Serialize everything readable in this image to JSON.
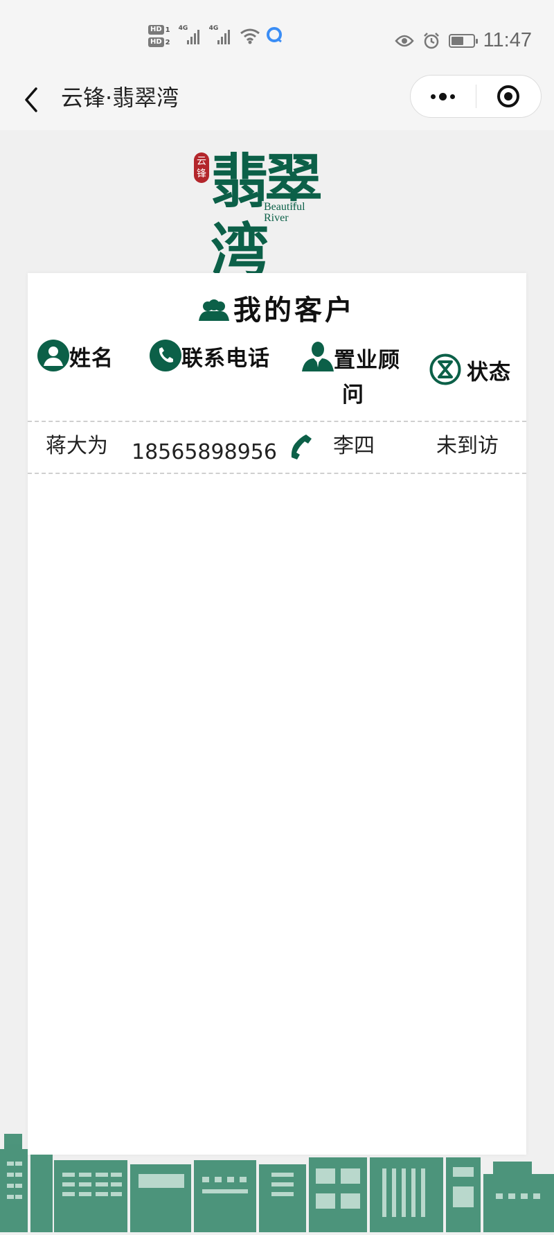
{
  "status_bar": {
    "hd1": "HD",
    "hd1_index": "1",
    "hd2": "HD",
    "hd2_index": "2",
    "network1": "4G",
    "network2": "4G",
    "time": "11:47",
    "battery_level": 0.58
  },
  "nav": {
    "title": "云锋·翡翠湾"
  },
  "logo": {
    "seal_text": "云锋",
    "main": "翡翠湾",
    "sub_line1": "Beautiful",
    "sub_line2": "River"
  },
  "customers": {
    "title": "我的客户",
    "headers": {
      "name": "姓名",
      "phone": "联系电话",
      "consultant_line1": "置业顾",
      "consultant_line2": "问",
      "status": "状态"
    },
    "rows": [
      {
        "name": "蒋大为",
        "phone": "18565898956",
        "consultant": "李四",
        "status": "未到访"
      }
    ]
  },
  "colors": {
    "brand_green": "#0c6048",
    "seal_red": "#b3262b",
    "background": "#f0f0f0"
  }
}
